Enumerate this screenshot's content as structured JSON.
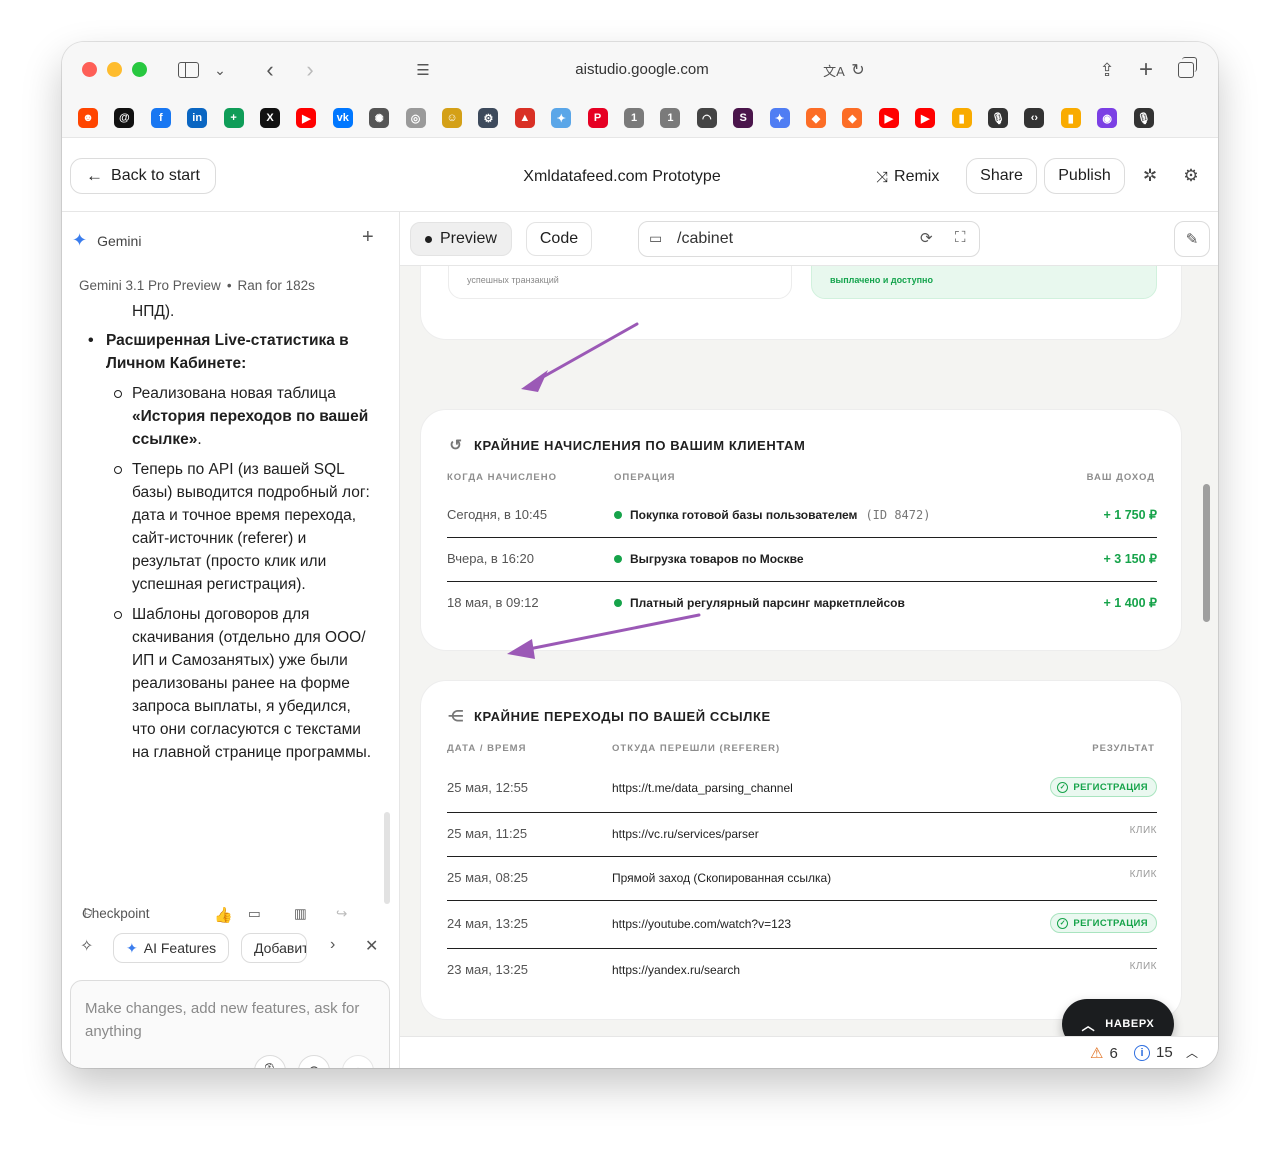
{
  "browser": {
    "url": "aistudio.google.com",
    "favorites": [
      {
        "icon": "reddit-icon",
        "color": "#ff4500",
        "glyph": "☻"
      },
      {
        "icon": "threads-icon",
        "color": "#111111",
        "glyph": "@"
      },
      {
        "icon": "facebook-icon",
        "color": "#1877f2",
        "glyph": "f"
      },
      {
        "icon": "linkedin-icon",
        "color": "#0a66c2",
        "glyph": "in"
      },
      {
        "icon": "sheets-icon",
        "color": "#0f9d58",
        "glyph": "+"
      },
      {
        "icon": "x-icon",
        "color": "#111111",
        "glyph": "X"
      },
      {
        "icon": "youtube-icon",
        "color": "#ff0000",
        "glyph": "▶"
      },
      {
        "icon": "vk-icon",
        "color": "#0077ff",
        "glyph": "vk"
      },
      {
        "icon": "openai-icon",
        "color": "#555555",
        "glyph": "✺"
      },
      {
        "icon": "compass-icon",
        "color": "#9a9a9a",
        "glyph": "◎"
      },
      {
        "icon": "emoji-icon",
        "color": "#d4a017",
        "glyph": "☺"
      },
      {
        "icon": "settings-app-icon",
        "color": "#3d4a5c",
        "glyph": "⚙"
      },
      {
        "icon": "alert-app-icon",
        "color": "#d93025",
        "glyph": "▲"
      },
      {
        "icon": "butterfly-icon",
        "color": "#5aa6e8",
        "glyph": "✦"
      },
      {
        "icon": "pinterest-icon",
        "color": "#e60023",
        "glyph": "P"
      },
      {
        "icon": "one-icon-a",
        "color": "#7a7a7a",
        "glyph": "1"
      },
      {
        "icon": "one-icon-b",
        "color": "#7a7a7a",
        "glyph": "1"
      },
      {
        "icon": "rainbow-icon",
        "color": "#444444",
        "glyph": "◠"
      },
      {
        "icon": "slack-icon",
        "color": "#4a154b",
        "glyph": "S"
      },
      {
        "icon": "gemini-icon",
        "color": "#4f7df3",
        "glyph": "✦"
      },
      {
        "icon": "gitlab-icon-a",
        "color": "#fc6d26",
        "glyph": "◆"
      },
      {
        "icon": "gitlab-icon-b",
        "color": "#fc6d26",
        "glyph": "◆"
      },
      {
        "icon": "youtube-icon-2",
        "color": "#ff0000",
        "glyph": "▶"
      },
      {
        "icon": "youtube-icon-3",
        "color": "#ff0000",
        "glyph": "▶"
      },
      {
        "icon": "analytics-icon-a",
        "color": "#f9ab00",
        "glyph": "▮"
      },
      {
        "icon": "microphone-fav-icon",
        "color": "#333333",
        "glyph": "🎙"
      },
      {
        "icon": "code-fav-icon",
        "color": "#333333",
        "glyph": "‹›"
      },
      {
        "icon": "analytics-icon-b",
        "color": "#f9ab00",
        "glyph": "▮"
      },
      {
        "icon": "loop-icon",
        "color": "#7b3fe4",
        "glyph": "◉"
      },
      {
        "icon": "microphone-fav-icon-2",
        "color": "#333333",
        "glyph": "🎙"
      }
    ]
  },
  "header": {
    "back_label": "Back to start",
    "title": "Xmldatafeed.com Prototype",
    "remix_label": "Remix",
    "share_label": "Share",
    "publish_label": "Publish"
  },
  "chat": {
    "assistant_name": "Gemini",
    "model_info": "Gemini 3.1 Pro Preview",
    "run_info": "Ran for 182s",
    "fragment": "НПД).",
    "bullet_title": "Расширенная Live-статистика в Личном Кабинете:",
    "sub1_pre": "Реализована новая таблица ",
    "sub1_bold": "«История переходов по вашей ссылке»",
    "sub1_post": ".",
    "sub2": "Теперь по API (из вашей SQL базы) выводится подробный лог: дата и точное время перехода, сайт-источник (referer) и результат (просто клик или успешная регистрация).",
    "sub3": "Шаблоны договоров для скачивания (отдельно для ООО/ИП и Самозанятых) уже были реализованы ранее на форме запроса выплаты, я убедился, что они согласуются с текстами на главной странице программы.",
    "checkpoint_label": "Checkpoint",
    "ai_features_label": "AI Features",
    "add_label": "Добавить",
    "prompt_placeholder": "Make changes, add new features, ask for anything"
  },
  "preview": {
    "tab_preview": "Preview",
    "tab_code": "Code",
    "route": "/cabinet",
    "top_card": {
      "left_label": "успешных транзакций",
      "right_label": "выплачено и доступно"
    },
    "accruals": {
      "title": "КРАЙНИЕ НАЧИСЛЕНИЯ ПО ВАШИМ КЛИЕНТАМ",
      "headers": [
        "КОГДА НАЧИСЛЕНО",
        "ОПЕРАЦИЯ",
        "ВАШ ДОХОД"
      ],
      "rows": [
        {
          "when": "Сегодня, в 10:45",
          "op": "Покупка готовой базы пользователем",
          "id": "(ID 8472)",
          "amount": "+ 1 750 ₽"
        },
        {
          "when": "Вчера, в 16:20",
          "op": "Выгрузка товаров по Москве",
          "id": "",
          "amount": "+ 3 150 ₽"
        },
        {
          "when": "18 мая, в 09:12",
          "op": "Платный регулярный парсинг маркетплейсов",
          "id": "",
          "amount": "+ 1 400 ₽"
        }
      ]
    },
    "visits": {
      "title": "КРАЙНИЕ ПЕРЕХОДЫ ПО ВАШЕЙ ССЫЛКЕ",
      "headers": [
        "ДАТА / ВРЕМЯ",
        "ОТКУДА ПЕРЕШЛИ (REFERER)",
        "РЕЗУЛЬТАТ"
      ],
      "rows": [
        {
          "date": "25 мая, 12:55",
          "referer": "https://t.me/data_parsing_channel",
          "result": "РЕГИСТРАЦИЯ"
        },
        {
          "date": "25 мая, 11:25",
          "referer": "https://vc.ru/services/parser",
          "result": "КЛИК"
        },
        {
          "date": "25 мая, 08:25",
          "referer": "Прямой заход (Скопированная ссылка)",
          "result": "КЛИК"
        },
        {
          "date": "24 мая, 13:25",
          "referer": "https://youtube.com/watch?v=123",
          "result": "РЕГИСТРАЦИЯ"
        },
        {
          "date": "23 мая, 13:25",
          "referer": "https://yandex.ru/search",
          "result": "КЛИК"
        }
      ]
    },
    "to_top_label": "НАВЕРХ",
    "warnings_count": "6",
    "info_count": "15"
  },
  "colors": {
    "accent_green": "#16a34a",
    "annotation_arrow": "#9b59b6",
    "gemini_blue": "#3b7ded"
  }
}
